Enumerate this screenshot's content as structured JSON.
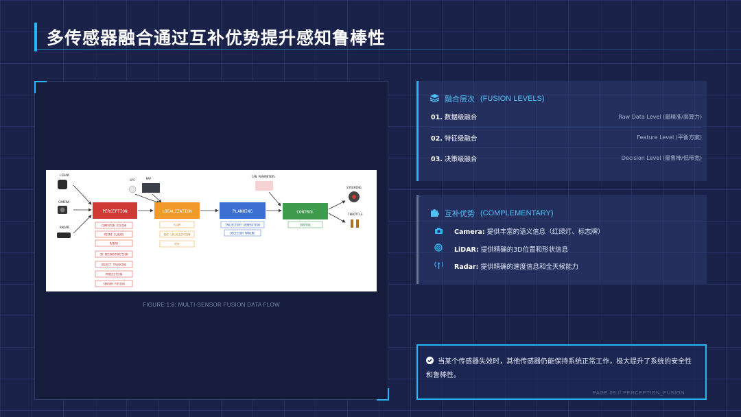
{
  "title": "多传感器融合通过互补优势提升感知鲁棒性",
  "figure": {
    "caption": "FIGURE 1.8: MULTI-SENSOR FUSION DATA FLOW",
    "sensors": [
      "LIDAR",
      "CAMERA",
      "RADAR"
    ],
    "inputs": [
      "GPS",
      "MAP",
      "CAN PARAMETERS"
    ],
    "stages": [
      {
        "label": "PERCEPTION",
        "color": "#d03a35",
        "items": [
          "COMPUTER VISION",
          "POINT CLOUDS",
          "RADAR",
          "3D RECONSTRUCTION",
          "OBJECT TRACKING",
          "PREDICTION",
          "SENSOR FUSION"
        ]
      },
      {
        "label": "LOCALIZATION",
        "color": "#ef9a2a",
        "items": [
          "SLAM",
          "EKF LOCALIZATION",
          "RTK"
        ]
      },
      {
        "label": "PLANNING",
        "color": "#3c6fd0",
        "items": [
          "TRAJECTORY GENERATION",
          "DECISION MAKING"
        ]
      },
      {
        "label": "CONTROL",
        "color": "#3f9b4e",
        "items": [
          "CONTROL"
        ]
      }
    ],
    "outputs": [
      "STEERING",
      "THROTTLE"
    ]
  },
  "fusion": {
    "header_zh": "融合层次",
    "header_en": "(FUSION LEVELS)",
    "icon": "layers-icon",
    "levels": [
      {
        "num": "01.",
        "name": "数据级融合",
        "desc": "Raw Data Level (最精准/高算力)"
      },
      {
        "num": "02.",
        "name": "特征级融合",
        "desc": "Feature Level (平衡方案)"
      },
      {
        "num": "03.",
        "name": "决策级融合",
        "desc": "Decision Level (最鲁棒/低带宽)"
      }
    ]
  },
  "complementary": {
    "header_zh": "互补优势",
    "header_en": "(COMPLEMENTARY)",
    "icon": "puzzle-icon",
    "items": [
      {
        "icon": "camera-icon",
        "name": "Camera:",
        "text": "提供丰富的语义信息（红绿灯、标志牌）"
      },
      {
        "icon": "lidar-icon",
        "name": "LiDAR:",
        "text": "提供精确的3D位置和形状信息"
      },
      {
        "icon": "radar-icon",
        "name": "Radar:",
        "text": "提供精确的速度信息和全天候能力"
      }
    ]
  },
  "note": {
    "text": "当某个传感器失效时，其他传感器仍能保持系统正常工作，极大提升了系统的安全性和鲁棒性。"
  },
  "page_label": "PAGE 09 // PERCEPTION_FUSION",
  "colors": {
    "accent": "#29b6f6",
    "background": "#1b2249"
  }
}
